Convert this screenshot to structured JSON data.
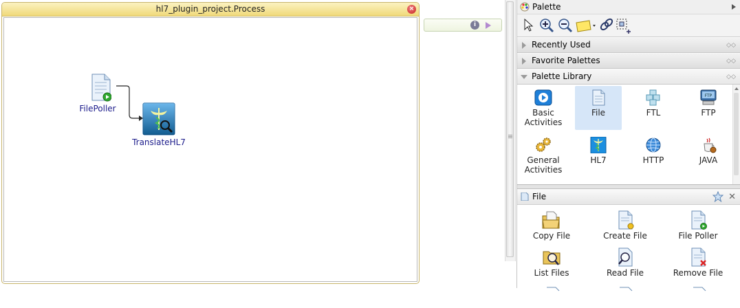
{
  "process": {
    "title": "hl7_plugin_project.Process",
    "nodes": [
      {
        "label": "FilePoller",
        "icon": "file-poller-icon"
      },
      {
        "label": "TranslateHL7",
        "icon": "hl7-caduceus-icon"
      }
    ]
  },
  "palette": {
    "title": "Palette",
    "drawers": {
      "recently_used": "Recently Used",
      "favorite_palettes": "Favorite Palettes",
      "palette_library": "Palette Library"
    },
    "library_items": [
      {
        "label": "Basic Activities",
        "icon": "basic-activities-icon"
      },
      {
        "label": "File",
        "icon": "file-icon",
        "selected": true
      },
      {
        "label": "FTL",
        "icon": "ftl-cubes-icon"
      },
      {
        "label": "FTP",
        "icon": "ftp-computer-icon"
      },
      {
        "label": "General Activities",
        "icon": "gears-icon"
      },
      {
        "label": "HL7",
        "icon": "hl7-caduceus-icon"
      },
      {
        "label": "HTTP",
        "icon": "globe-icon"
      },
      {
        "label": "JAVA",
        "icon": "java-cup-icon"
      }
    ],
    "file_section": {
      "title": "File",
      "items": [
        {
          "label": "Copy File",
          "icon": "copy-file-icon"
        },
        {
          "label": "Create File",
          "icon": "create-file-icon"
        },
        {
          "label": "File Poller",
          "icon": "file-poller-icon"
        },
        {
          "label": "List Files",
          "icon": "list-files-icon"
        },
        {
          "label": "Read File",
          "icon": "read-file-icon"
        },
        {
          "label": "Remove File",
          "icon": "remove-file-icon"
        }
      ]
    }
  },
  "colors": {
    "title_bar": "#f0d97a",
    "node_label": "#1a1a8a",
    "selected": "#d6e6f8"
  }
}
